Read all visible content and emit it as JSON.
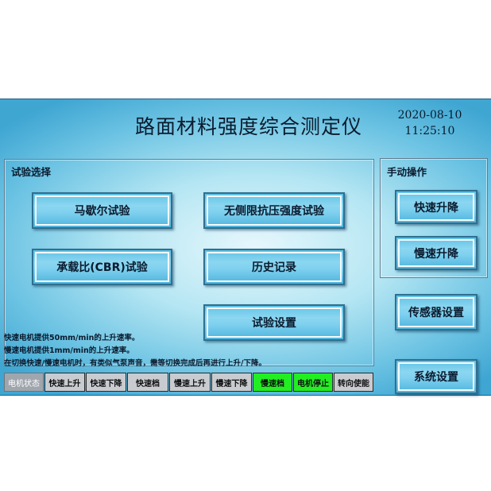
{
  "header": {
    "title": "路面材料强度综合测定仪",
    "date": "2020-08-10",
    "time": "11:25:10"
  },
  "test_panel": {
    "label": "试验选择",
    "buttons": [
      "马歇尔试验",
      "无侧限抗压强度试验",
      "承载比(CBR)试验",
      "历史记录",
      "试验设置"
    ]
  },
  "manual_panel": {
    "label": "手动操作",
    "buttons": [
      "快速升降",
      "慢速升降"
    ]
  },
  "side_buttons": {
    "sensor": "传感器设置",
    "system": "系统设置"
  },
  "info_lines": [
    "快速电机提供50mm/min的上升速率。",
    "慢速电机提供1mm/min的上升速率。",
    "在切换快速/慢速电机时，有类似气泵声音，需等切换完成后再进行上升/下降。"
  ],
  "motor_status": {
    "label": "电机状态",
    "items": [
      {
        "text": "快速上升",
        "active": false
      },
      {
        "text": "快速下降",
        "active": false
      },
      {
        "text": "快速档",
        "active": false
      },
      {
        "text": "慢速上升",
        "active": false
      },
      {
        "text": "慢速下降",
        "active": false
      },
      {
        "text": "慢速档",
        "active": true
      },
      {
        "text": "电机停止",
        "active": true
      },
      {
        "text": "转向使能",
        "active": false
      }
    ]
  },
  "colors": {
    "active_status": "#22ee22",
    "inactive_status": "#c8cbcf",
    "button_face": "#7fd1ef"
  }
}
